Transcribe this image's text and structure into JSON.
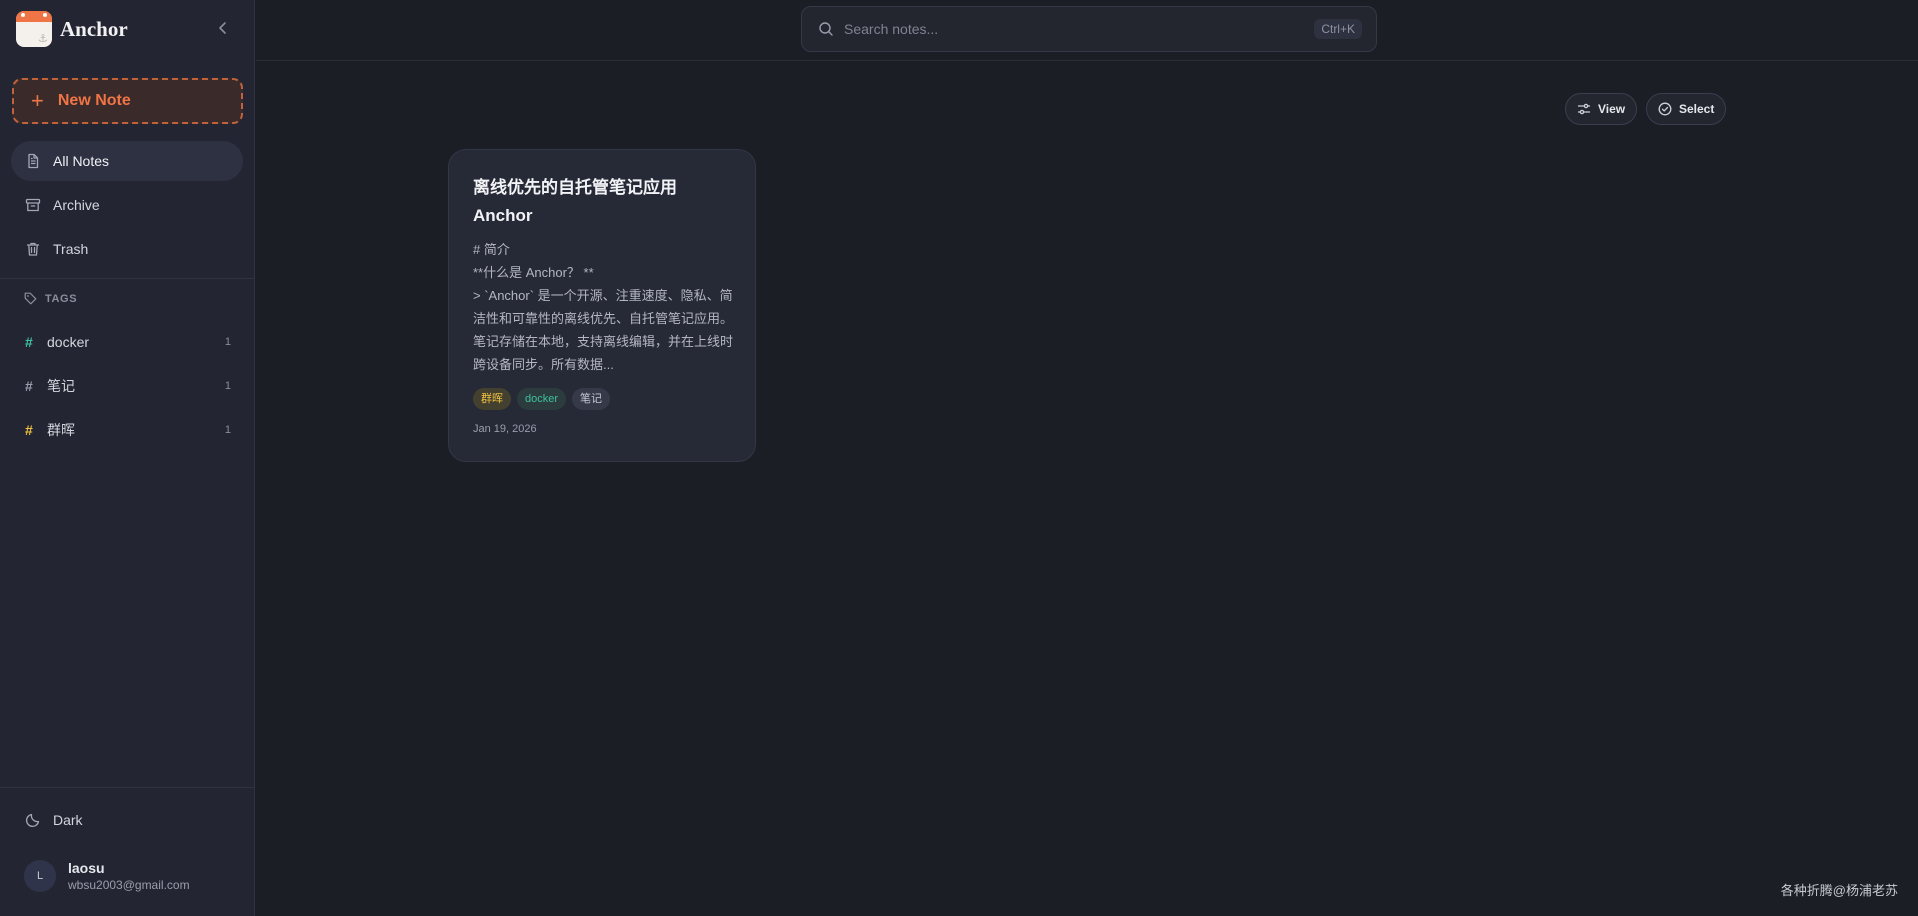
{
  "app": {
    "name": "Anchor",
    "accent": "#ef7446"
  },
  "sidebar": {
    "new_note_label": "New Note",
    "nav": [
      {
        "label": "All Notes",
        "icon": "file-text-icon",
        "active": true
      },
      {
        "label": "Archive",
        "icon": "archive-box-icon",
        "active": false
      },
      {
        "label": "Trash",
        "icon": "trash-icon",
        "active": false
      }
    ],
    "tags_heading": "TAGS",
    "tags": [
      {
        "name": "docker",
        "count": "1",
        "color": "#3ec1a2"
      },
      {
        "name": "笔记",
        "count": "1",
        "color": "#9a9eac"
      },
      {
        "name": "群晖",
        "count": "1",
        "color": "#f0c040"
      }
    ],
    "theme_label": "Dark",
    "user": {
      "initial": "L",
      "name": "laosu",
      "email": "wbsu2003@gmail.com"
    }
  },
  "search": {
    "placeholder": "Search notes...",
    "shortcut": "Ctrl+K"
  },
  "toolbar": {
    "view_label": "View",
    "select_label": "Select"
  },
  "notes": [
    {
      "title": "离线优先的自托管笔记应用 Anchor",
      "body_lines": [
        "# 简介",
        "**什么是 Anchor？ **",
        "> `Anchor` 是一个开源、注重速度、隐私、简洁性和可靠性的离线优先、自托管笔记应用。笔记存储在本地，支持离线编辑，并在上线时跨设备同步。所有数据..."
      ],
      "tags": [
        {
          "name": "群晖",
          "text_color": "#f0c040",
          "bg": "#43402f"
        },
        {
          "name": "docker",
          "text_color": "#3ec1a2",
          "bg": "#2c3b3d"
        },
        {
          "name": "笔记",
          "text_color": "#c5c8d2",
          "bg": "#363a48"
        }
      ],
      "date": "Jan 19, 2026"
    }
  ],
  "watermark": "各种折腾@杨浦老苏"
}
